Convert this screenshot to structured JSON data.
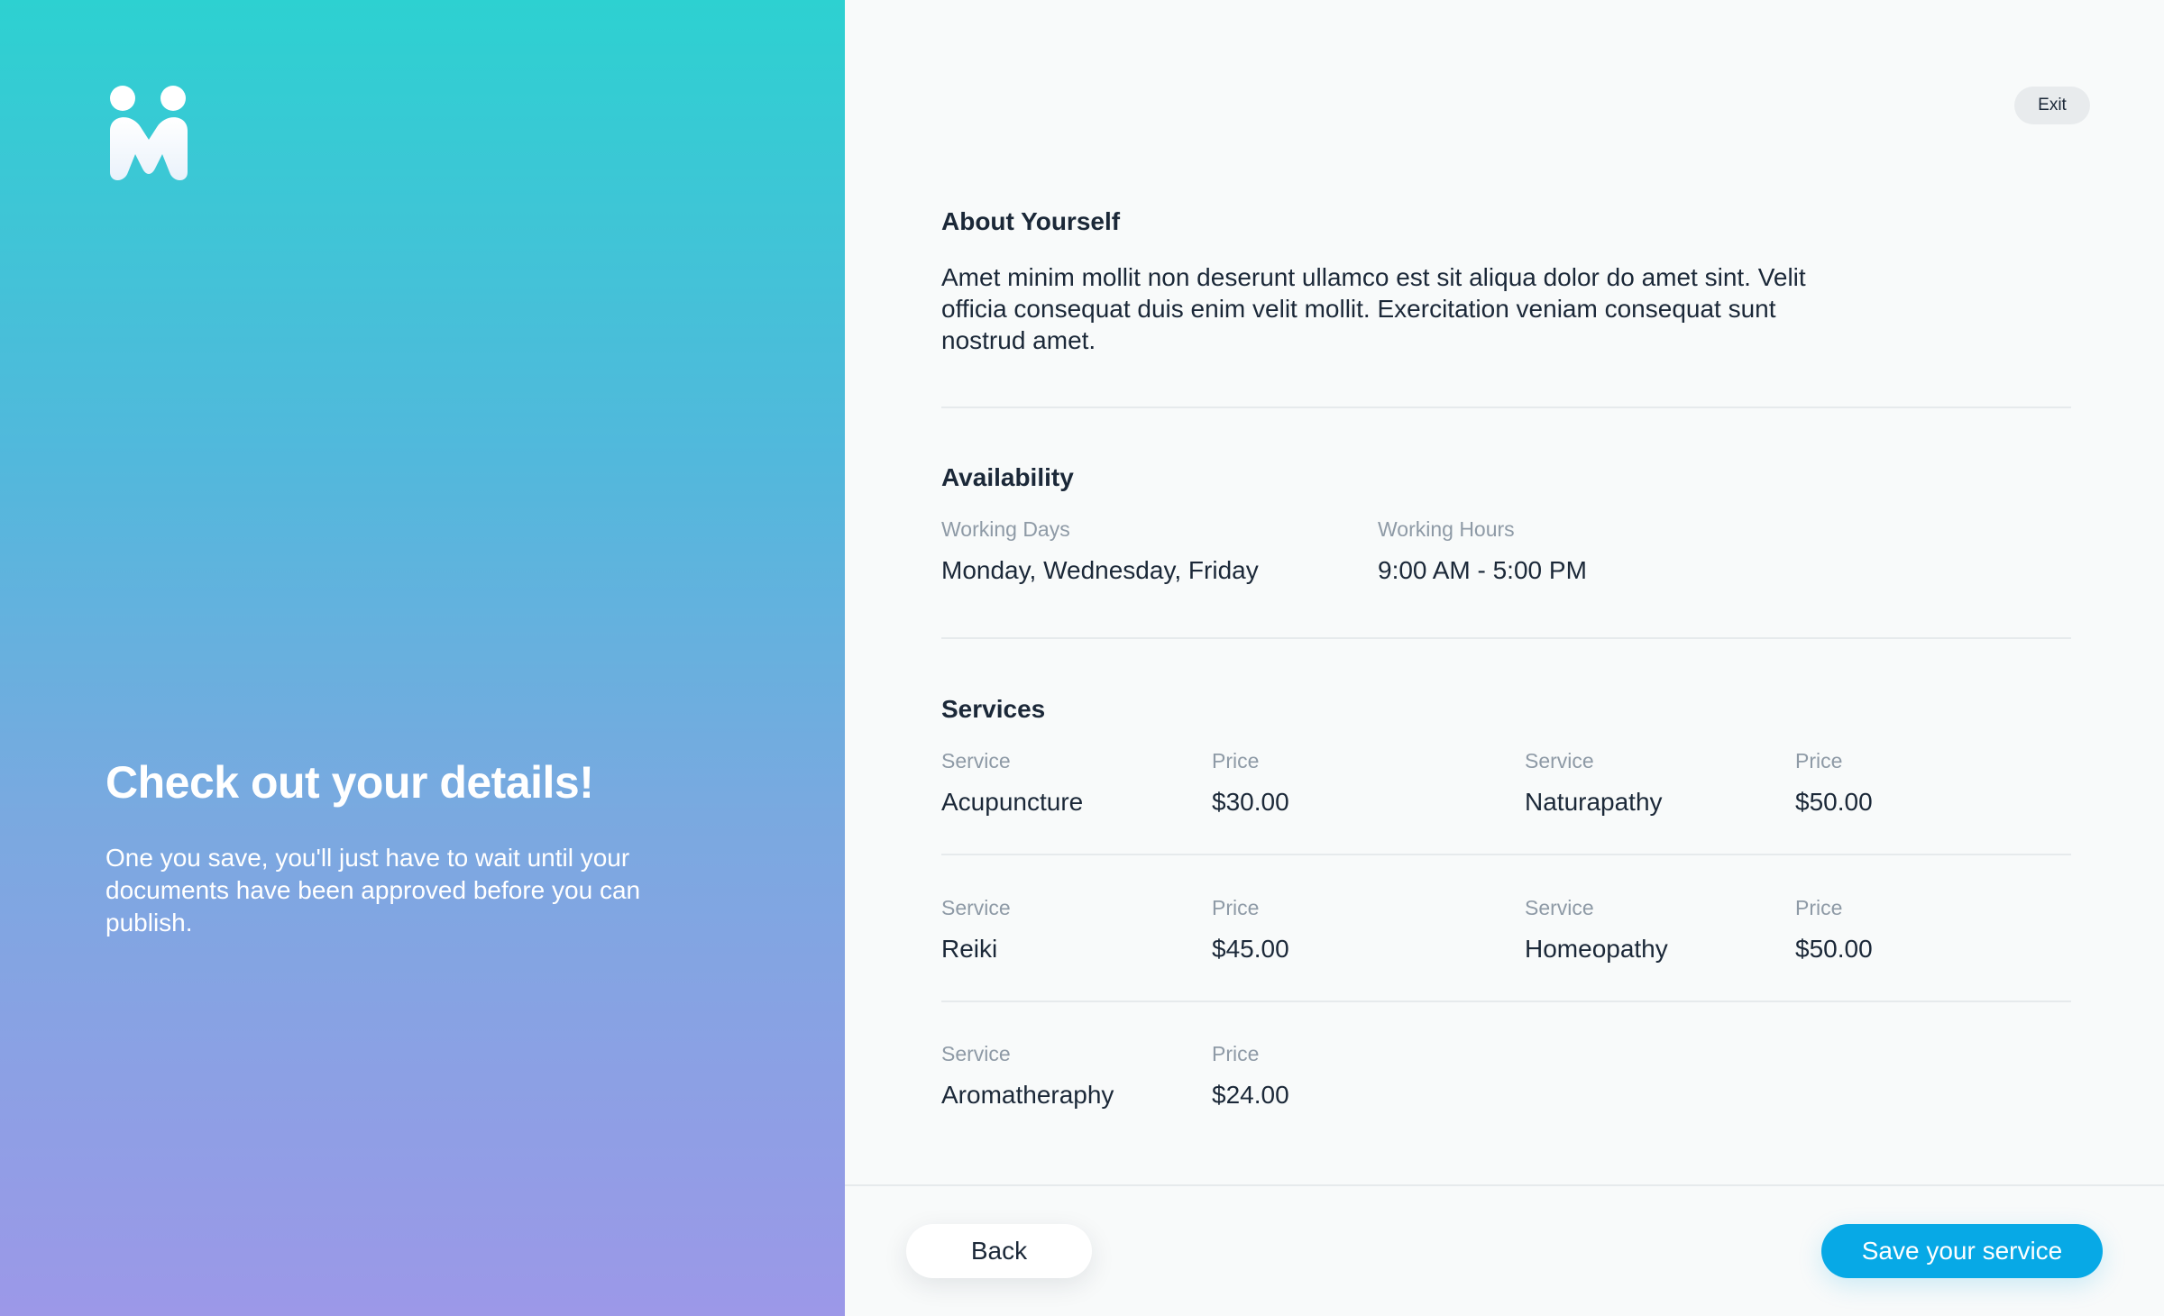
{
  "brand": {
    "logo_icon": "brand-logo-icon"
  },
  "intro": {
    "title": "Check out your details!",
    "subtitle": "One you save, you'll just have to wait until your documents have been approved before you can publish."
  },
  "header": {
    "exit_label": "Exit"
  },
  "about": {
    "title": "About Yourself",
    "text": "Amet minim mollit non deserunt ullamco est sit aliqua dolor do amet sint. Velit officia consequat duis enim velit mollit. Exercitation veniam consequat sunt nostrud amet."
  },
  "availability": {
    "title": "Availability",
    "days_label": "Working Days",
    "days_value": "Monday, Wednesday, Friday",
    "hours_label": "Working Hours",
    "hours_value": "9:00 AM - 5:00 PM"
  },
  "services": {
    "title": "Services",
    "service_label": "Service",
    "price_label": "Price",
    "items": [
      {
        "name": "Acupuncture",
        "price": "$30.00"
      },
      {
        "name": "Naturapathy",
        "price": "$50.00"
      },
      {
        "name": "Reiki",
        "price": "$45.00"
      },
      {
        "name": "Homeopathy",
        "price": "$50.00"
      },
      {
        "name": "Aromatheraphy",
        "price": "$24.00"
      }
    ]
  },
  "footer": {
    "back_label": "Back",
    "save_label": "Save your service"
  },
  "colors": {
    "accent": "#07a9e6",
    "gradient_top": "#2dd1d1",
    "gradient_bottom": "#9c98e8",
    "text_primary": "#1b2838",
    "text_muted": "#8e9aa6"
  }
}
